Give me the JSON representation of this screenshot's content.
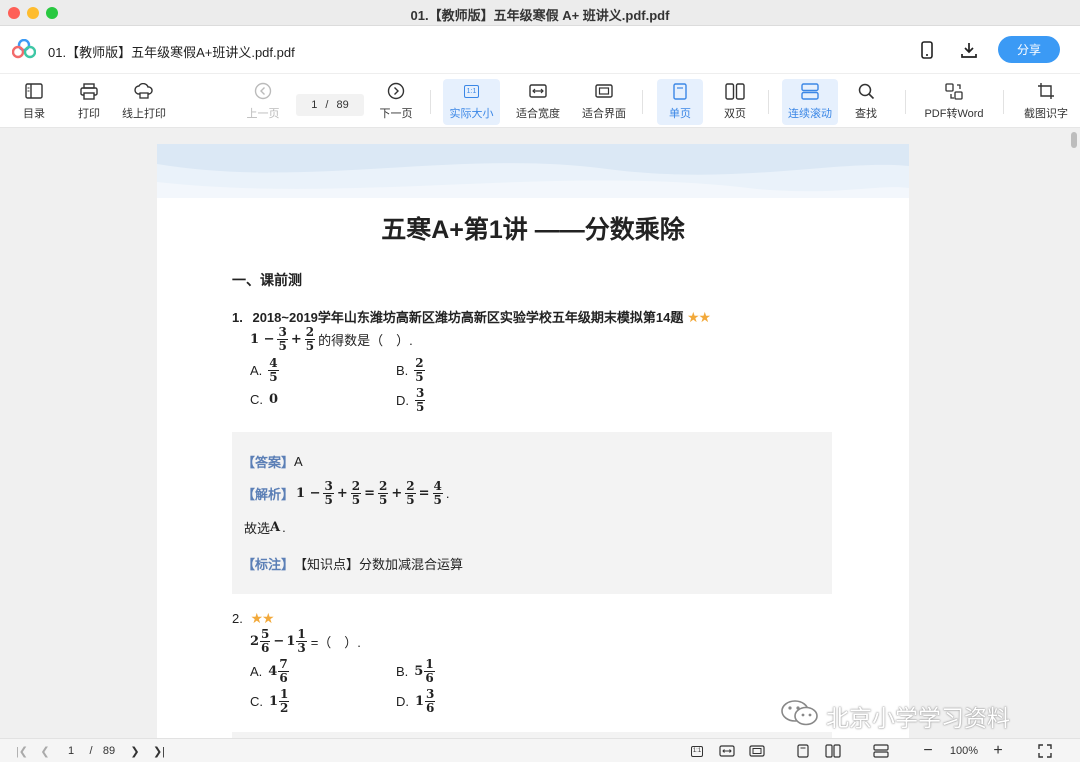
{
  "window": {
    "title": "01.【教师版】五年级寒假 A+ 班讲义.pdf.pdf"
  },
  "header": {
    "file_name": "01.【教师版】五年级寒假A+班讲义.pdf.pdf",
    "share_label": "分享",
    "icons": [
      "app-logo-icon",
      "phone-icon",
      "download-icon"
    ]
  },
  "toolbar": {
    "toc": "目录",
    "print": "打印",
    "online_print": "线上打印",
    "prev_page": "上一页",
    "current_page": "1",
    "page_sep": "/",
    "total_pages": "89",
    "next_page": "下一页",
    "actual_size": "实际大小",
    "actual_size_icon_text": "1:1",
    "fit_width": "适合宽度",
    "fit_page": "适合界面",
    "single_page": "单页",
    "double_page": "双页",
    "continuous": "连续滚动",
    "find": "查找",
    "pdf_to_word": "PDF转Word",
    "ocr": "截图识字"
  },
  "doc": {
    "title": "五寒A+第1讲 ——分数乘除",
    "section1": "一、课前测",
    "q1": {
      "num": "1.",
      "source": "2018~2019学年山东潍坊高新区潍坊高新区实验学校五年级期末模拟第14题",
      "stars": "★★",
      "expr_prefix": "1 −",
      "f1": {
        "n": "3",
        "d": "5"
      },
      "plus": "+",
      "f2": {
        "n": "2",
        "d": "5"
      },
      "suffix": "的得数是（　）.",
      "opt_a_label": "A.",
      "opt_a": {
        "n": "4",
        "d": "5"
      },
      "opt_b_label": "B.",
      "opt_b": {
        "n": "2",
        "d": "5"
      },
      "opt_c_label": "C.",
      "opt_c": "0",
      "opt_d_label": "D.",
      "opt_d": {
        "n": "3",
        "d": "5"
      }
    },
    "answer": {
      "answer_tag": "【答案】",
      "answer_val": "A",
      "analysis_tag": "【解析】",
      "a1": "1 −",
      "a_f1": {
        "n": "3",
        "d": "5"
      },
      "a_plus1": "+",
      "a_f2": {
        "n": "2",
        "d": "5"
      },
      "a_eq1": "=",
      "a_f3": {
        "n": "2",
        "d": "5"
      },
      "a_plus2": "+",
      "a_f4": {
        "n": "2",
        "d": "5"
      },
      "a_eq2": "=",
      "a_f5": {
        "n": "4",
        "d": "5"
      },
      "a_end": ".",
      "choose_prefix": "故选",
      "choose_val": "A",
      "choose_end": ".",
      "note_tag": "【标注】",
      "note_val": "【知识点】分数加减混合运算"
    },
    "q2": {
      "num": "2.",
      "stars": "★★",
      "w1": "2",
      "f1": {
        "n": "5",
        "d": "6"
      },
      "minus": "−",
      "w2": "1",
      "f2": {
        "n": "1",
        "d": "3"
      },
      "suffix": "=（　）.",
      "opt_a_label": "A.",
      "opt_a_w": "4",
      "opt_a": {
        "n": "7",
        "d": "6"
      },
      "opt_b_label": "B.",
      "opt_b_w": "5",
      "opt_b": {
        "n": "1",
        "d": "6"
      },
      "opt_c_label": "C.",
      "opt_c_w": "1",
      "opt_c": {
        "n": "1",
        "d": "2"
      },
      "opt_d_label": "D.",
      "opt_d_w": "1",
      "opt_d": {
        "n": "3",
        "d": "6"
      }
    }
  },
  "watermark": "北京小学学习资料",
  "statusbar": {
    "current_page": "1",
    "page_sep": "/",
    "total_pages": "89",
    "zoom": "100%",
    "actual_size_icon_text": "1:1"
  },
  "colors": {
    "accent": "#3b9af5",
    "star": "#f2a93b",
    "tag": "#5b7fb6"
  }
}
